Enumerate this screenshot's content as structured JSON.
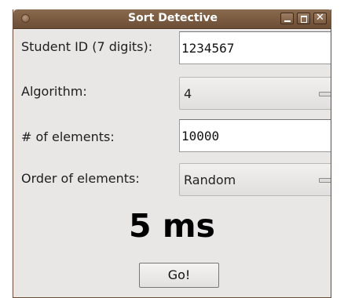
{
  "window": {
    "title": "Sort Detective"
  },
  "form": {
    "student_id": {
      "label": "Student ID (7 digits):",
      "value": "1234567"
    },
    "algorithm": {
      "label": "Algorithm:",
      "value": "4"
    },
    "num_elements": {
      "label": "# of elements:",
      "value": "10000"
    },
    "order": {
      "label": "Order of elements:",
      "value": "Random"
    }
  },
  "result": {
    "text": "5 ms"
  },
  "go_button": {
    "label": "Go!"
  }
}
